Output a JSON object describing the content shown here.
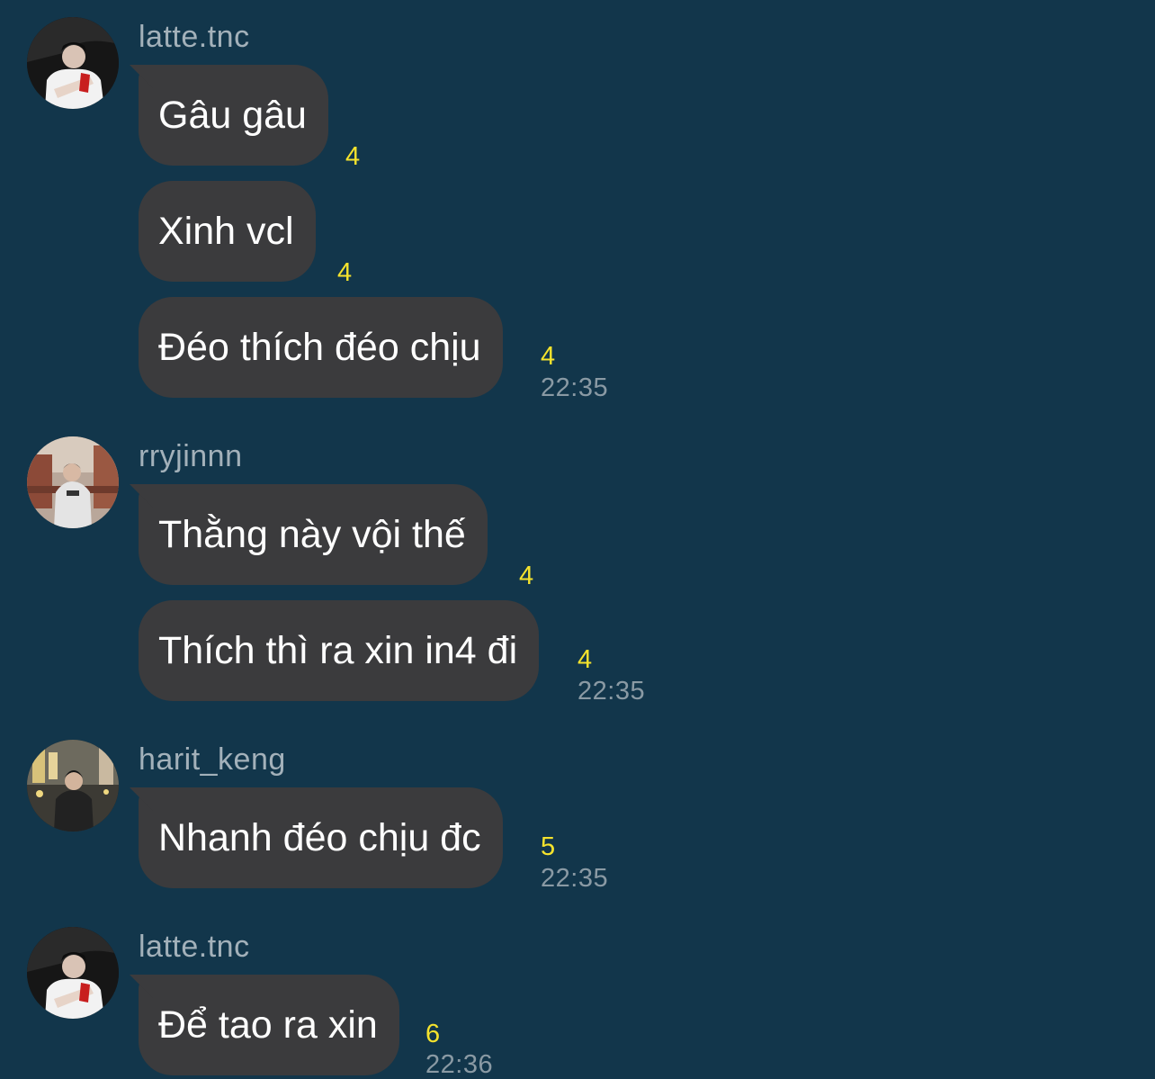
{
  "groups": [
    {
      "sender": "latte.tnc",
      "messages": [
        {
          "text": "Gâu gâu",
          "read": "4"
        },
        {
          "text": "Xinh vcl",
          "read": "4"
        },
        {
          "text": "Đéo thích đéo chịu",
          "read": "4",
          "time": "22:35"
        }
      ]
    },
    {
      "sender": "rryjinnn",
      "messages": [
        {
          "text": "Thằng này vội thế",
          "read": "4"
        },
        {
          "text": "Thích thì ra xin in4 đi",
          "read": "4",
          "time": "22:35"
        }
      ]
    },
    {
      "sender": "harit_keng",
      "messages": [
        {
          "text": "Nhanh đéo chịu đc",
          "read": "5",
          "time": "22:35"
        }
      ]
    },
    {
      "sender": "latte.tnc",
      "messages": [
        {
          "text": "Để tao ra xin",
          "read": "6",
          "time": "22:36"
        }
      ]
    }
  ]
}
